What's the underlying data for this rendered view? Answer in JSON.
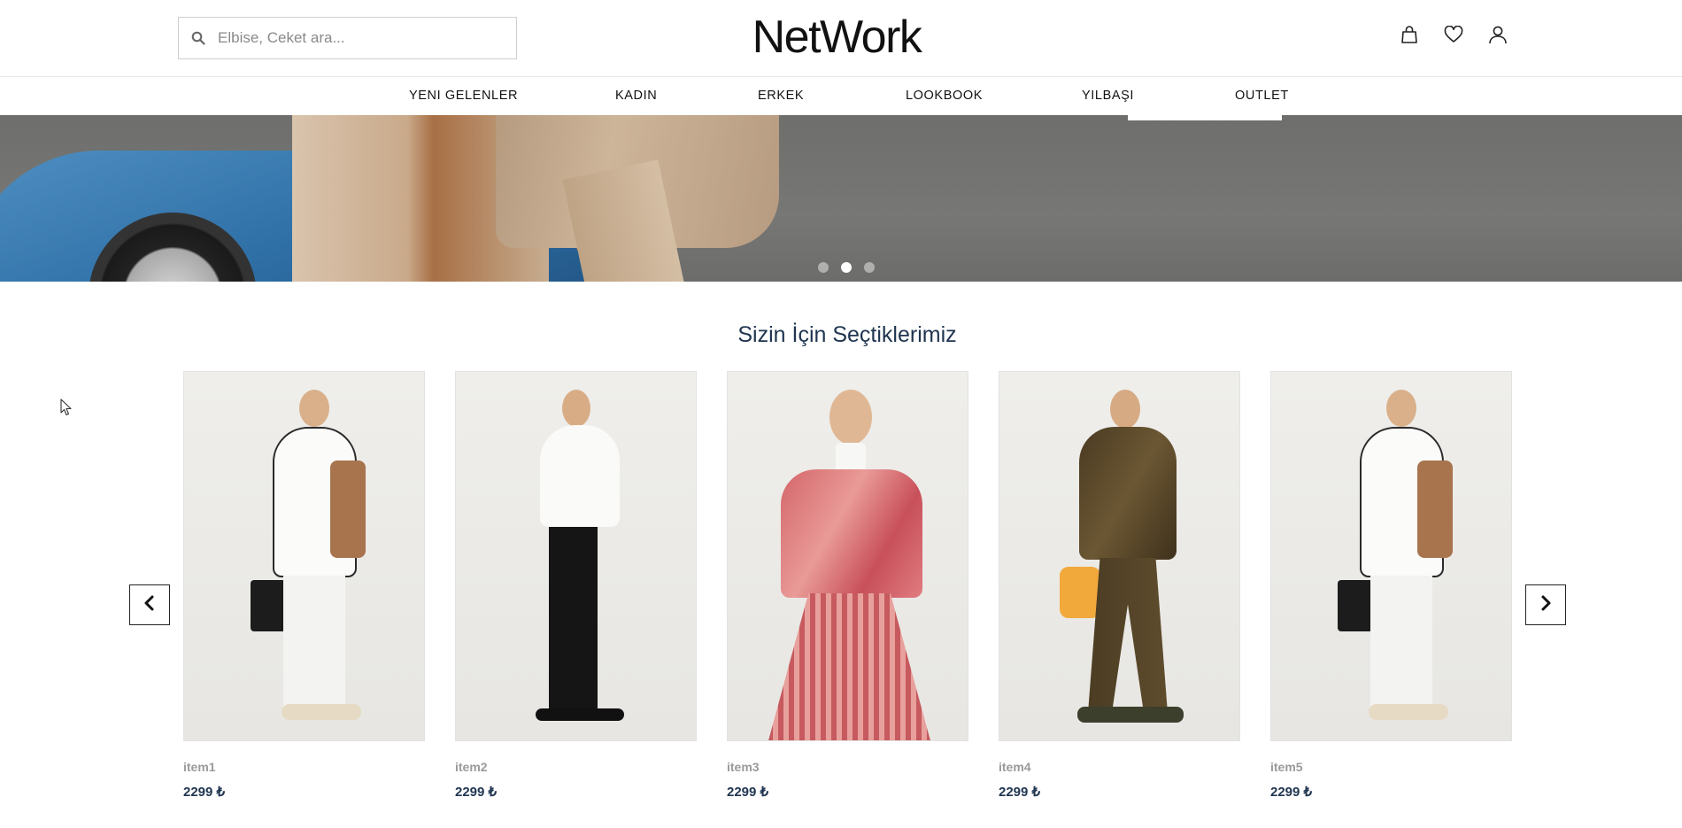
{
  "header": {
    "search_placeholder": "Elbise, Ceket ara...",
    "logo": "NetWork",
    "icons": [
      "bag-icon",
      "heart-icon",
      "user-icon"
    ]
  },
  "nav": {
    "items": [
      "YENI GELENLER",
      "KADIN",
      "ERKEK",
      "LOOKBOOK",
      "YILBAŞI",
      "OUTLET"
    ]
  },
  "hero": {
    "slide_count": 3,
    "active_slide": 2
  },
  "section": {
    "title": "Sizin İçin Seçtiklerimiz"
  },
  "products": [
    {
      "name": "item1",
      "price": "2299 ₺"
    },
    {
      "name": "item2",
      "price": "2299 ₺"
    },
    {
      "name": "item3",
      "price": "2299 ₺"
    },
    {
      "name": "item4",
      "price": "2299 ₺"
    },
    {
      "name": "item5",
      "price": "2299 ₺"
    }
  ],
  "colors": {
    "title": "#1f3550",
    "price": "#1f3550",
    "product_name": "#9a9a9a",
    "nav_text": "#111111"
  }
}
